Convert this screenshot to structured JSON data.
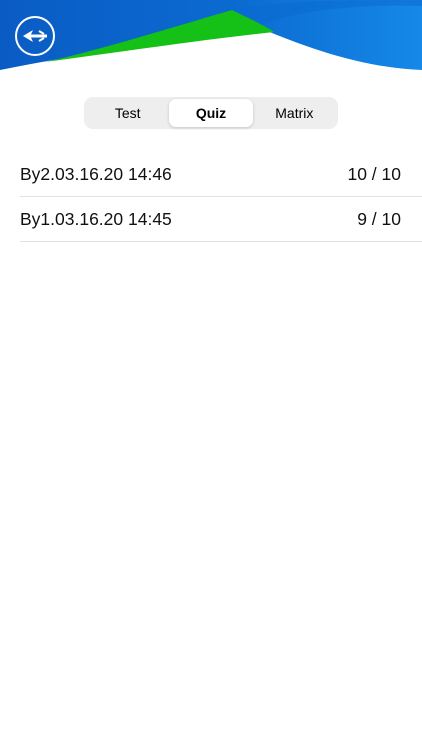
{
  "header": {
    "colors": {
      "blue": "#0b6bd1",
      "green": "#15c116"
    },
    "back_icon": "back-arrow-icon"
  },
  "tabs": [
    {
      "label": "Test",
      "selected": false
    },
    {
      "label": "Quiz",
      "selected": true
    },
    {
      "label": "Matrix",
      "selected": false
    }
  ],
  "results": [
    {
      "title": "By2.03.16.20 14:46",
      "score": "10 / 10"
    },
    {
      "title": "By1.03.16.20 14:45",
      "score": "9 / 10"
    }
  ]
}
